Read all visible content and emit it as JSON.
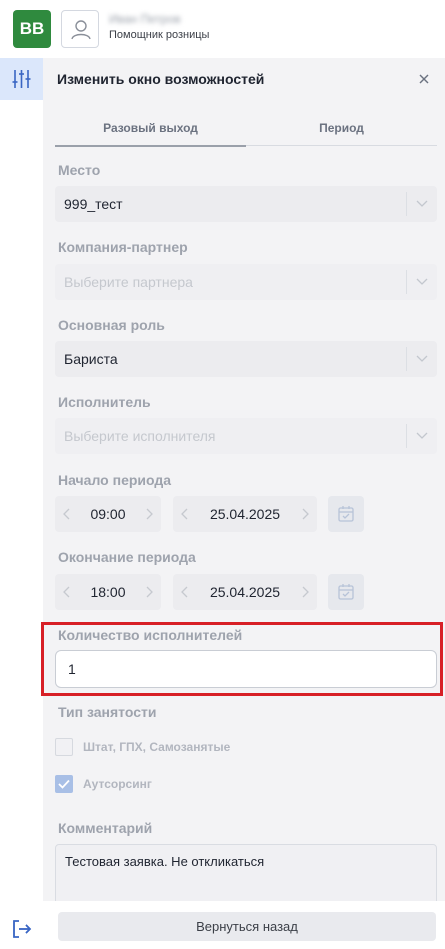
{
  "app": {
    "logo_text": "BB",
    "user_name": "Иван Петров",
    "user_role": "Помощник розницы"
  },
  "panel": {
    "title": "Изменить окно возможностей"
  },
  "tabs": [
    {
      "label": "Разовый выход",
      "active": true
    },
    {
      "label": "Период",
      "active": false
    }
  ],
  "form": {
    "place": {
      "label": "Место",
      "value": "999_тест"
    },
    "partner": {
      "label": "Компания-партнер",
      "placeholder": "Выберите партнера"
    },
    "role": {
      "label": "Основная роль",
      "value": "Бариста"
    },
    "executor": {
      "label": "Исполнитель",
      "placeholder": "Выберите исполнителя"
    },
    "start": {
      "label": "Начало периода",
      "time": "09:00",
      "date": "25.04.2025"
    },
    "end": {
      "label": "Окончание периода",
      "time": "18:00",
      "date": "25.04.2025"
    },
    "count": {
      "label": "Количество исполнителей",
      "value": "1"
    },
    "employment": {
      "label": "Тип занятости",
      "options": [
        {
          "label": "Штат, ГПХ, Самозанятые",
          "checked": false
        },
        {
          "label": "Аутсорсинг",
          "checked": true
        }
      ]
    },
    "comment": {
      "label": "Комментарий",
      "value": "Тестовая заявка. Не откликаться"
    }
  },
  "footer": {
    "back_label": "Вернуться назад"
  },
  "colors": {
    "accent_highlight": "#d71f26",
    "logo_green": "#2f8a3e",
    "rail_active": "#dbe7fb"
  }
}
